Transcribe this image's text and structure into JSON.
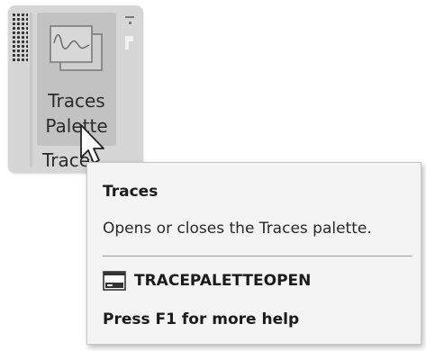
{
  "ribbon": {
    "button": {
      "label_line1": "Traces",
      "label_line2": "Palette",
      "icon": "traces-palette-icon"
    },
    "panel_title": "Traces",
    "grip_icon": "panel-grip-icon",
    "side_icons": [
      "minimize-panel-icon",
      "panel-options-icon"
    ]
  },
  "cursor": {
    "icon": "mouse-pointer-icon"
  },
  "tooltip": {
    "title": "Traces",
    "description": "Opens or closes the Traces palette.",
    "command_icon": "command-line-icon",
    "command": "TRACEPALETTEOPEN",
    "help": "Press F1 for more help"
  },
  "colors": {
    "panel_bg": "#d6d6d6",
    "button_hover_bg": "#c2c2c2",
    "tooltip_bg": "#f4f4f4",
    "text": "#2b2b2b"
  }
}
